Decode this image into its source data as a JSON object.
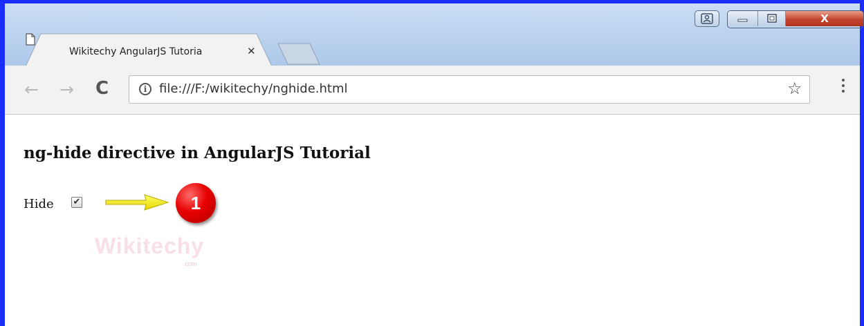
{
  "window": {
    "close_glyph": "X",
    "controls": [
      "user-icon",
      "minimize-icon",
      "maximize-icon",
      "close-icon"
    ]
  },
  "tab": {
    "title": "Wikitechy AngularJS Tutoria",
    "close_glyph": "✕"
  },
  "toolbar": {
    "back_glyph": "←",
    "forward_glyph": "→",
    "reload_glyph": "C",
    "info_glyph": "i",
    "url": "file:///F:/wikitechy/nghide.html",
    "bookmark_glyph": "☆",
    "menu_glyph": "⋮"
  },
  "content": {
    "heading": "ng-hide directive in AngularJS Tutorial",
    "checkbox_label": "Hide",
    "checkbox_checked": true,
    "checkbox_glyph": "✔",
    "callout_number": "1",
    "watermark": "Wikitechy",
    "watermark_sub": ".com"
  },
  "colors": {
    "frame_border": "#1a2cff",
    "callout_red": "#e60000",
    "arrow_yellow": "#f5f500"
  }
}
